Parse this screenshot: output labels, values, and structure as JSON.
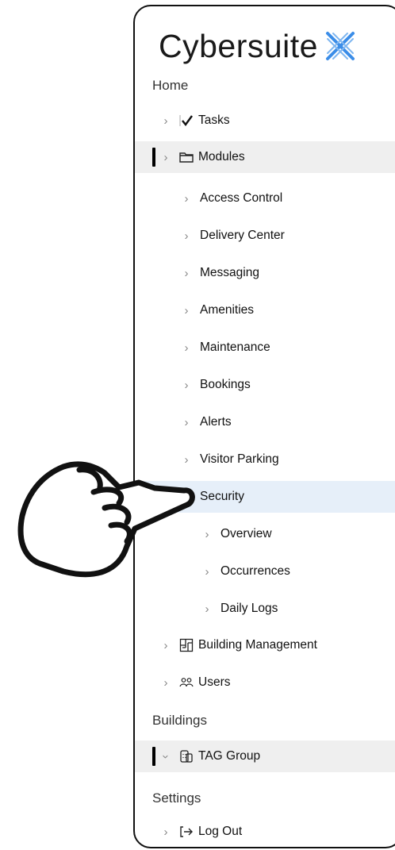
{
  "brand": {
    "name": "Cybersuite",
    "logo_icon": "cross-x-logo",
    "accent": "#3b8de8"
  },
  "sections": {
    "home": "Home",
    "buildings": "Buildings",
    "settings": "Settings"
  },
  "nav": {
    "tasks": "Tasks",
    "modules": "Modules",
    "module_items": [
      "Access Control",
      "Delivery Center",
      "Messaging",
      "Amenities",
      "Maintenance",
      "Bookings",
      "Alerts",
      "Visitor Parking"
    ],
    "security": "Security",
    "security_items": [
      "Overview",
      "Occurrences",
      "Daily Logs"
    ],
    "building_management": "Building Management",
    "users": "Users",
    "tag_group": "TAG Group",
    "log_out": "Log Out"
  },
  "colors": {
    "selected_bg": "#e6eff9",
    "active_bg": "#efefef",
    "active_marker": "#000000"
  }
}
